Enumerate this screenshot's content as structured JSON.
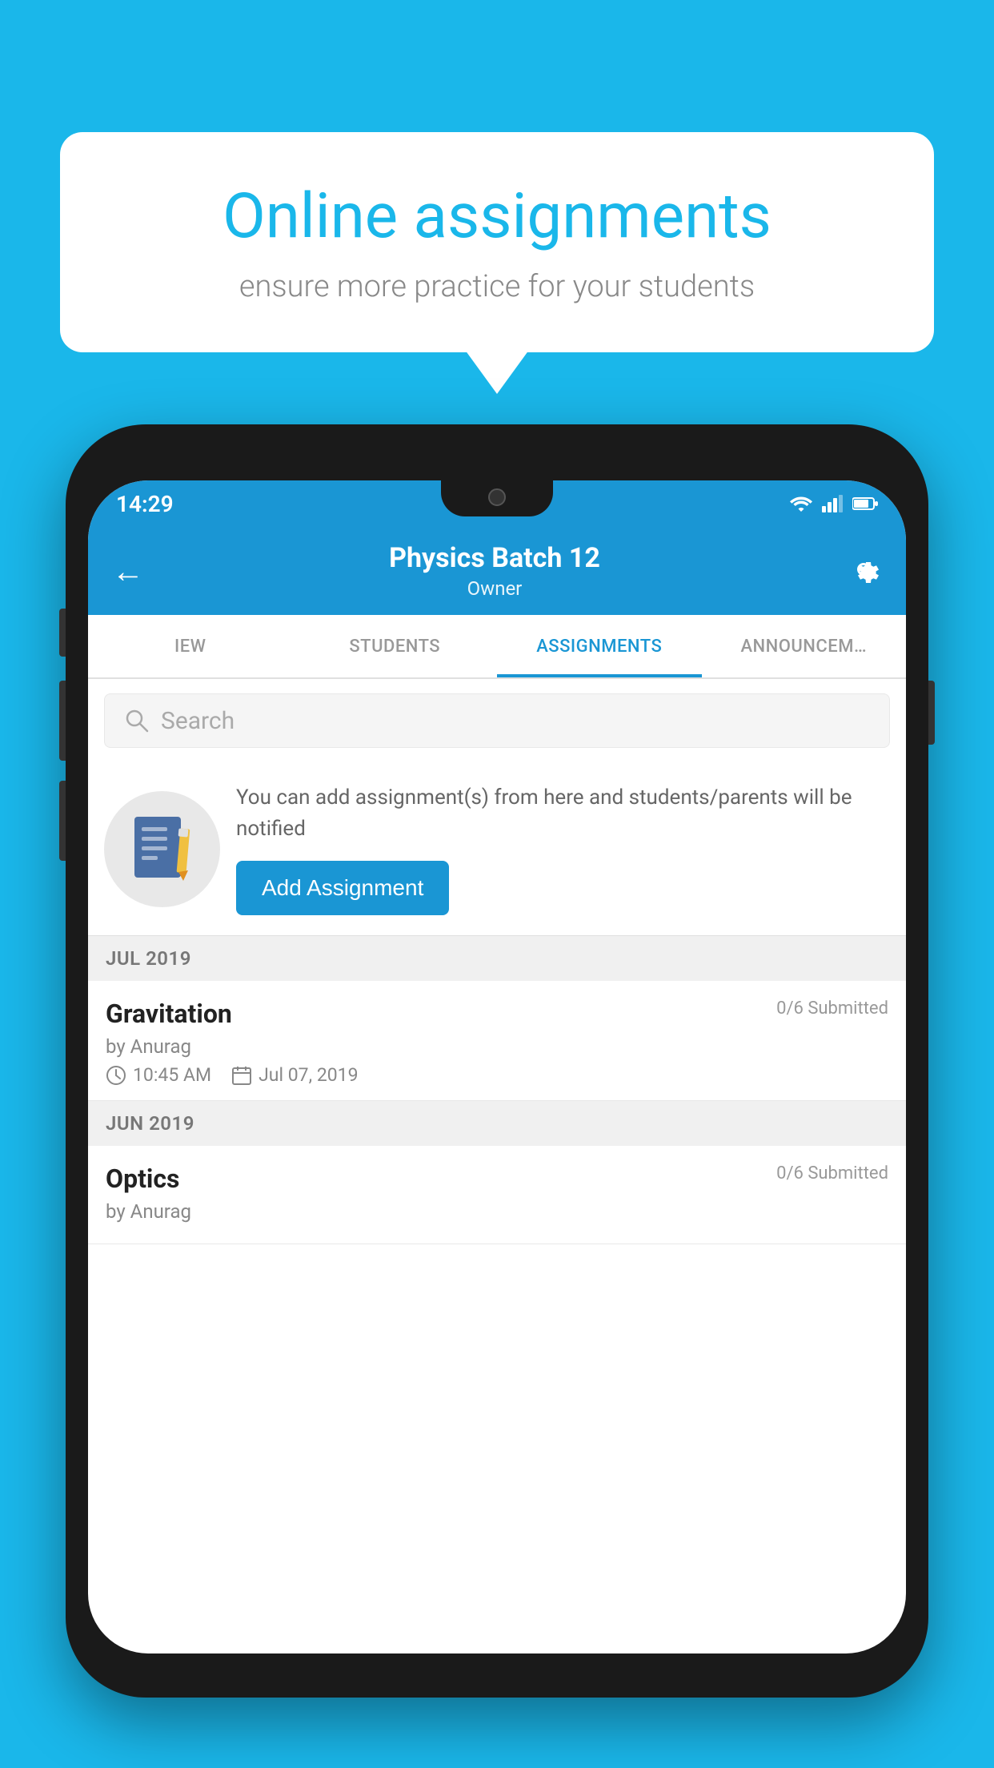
{
  "background_color": "#1ab7ea",
  "speech_bubble": {
    "title": "Online assignments",
    "subtitle": "ensure more practice for your students"
  },
  "phone": {
    "status_bar": {
      "time": "14:29",
      "icons": [
        "wifi",
        "signal",
        "battery"
      ]
    },
    "app_bar": {
      "title": "Physics Batch 12",
      "subtitle": "Owner",
      "back_label": "←",
      "settings_label": "⚙"
    },
    "tabs": [
      {
        "label": "IEW",
        "active": false
      },
      {
        "label": "STUDENTS",
        "active": false
      },
      {
        "label": "ASSIGNMENTS",
        "active": true
      },
      {
        "label": "ANNOUNCEM…",
        "active": false
      }
    ],
    "search": {
      "placeholder": "Search"
    },
    "promo": {
      "description": "You can add assignment(s) from here and students/parents will be notified",
      "button_label": "Add Assignment"
    },
    "sections": [
      {
        "header": "JUL 2019",
        "assignments": [
          {
            "name": "Gravitation",
            "submitted": "0/6 Submitted",
            "author": "by Anurag",
            "time": "10:45 AM",
            "date": "Jul 07, 2019"
          }
        ]
      },
      {
        "header": "JUN 2019",
        "assignments": [
          {
            "name": "Optics",
            "submitted": "0/6 Submitted",
            "author": "by Anurag",
            "time": "",
            "date": ""
          }
        ]
      }
    ]
  }
}
